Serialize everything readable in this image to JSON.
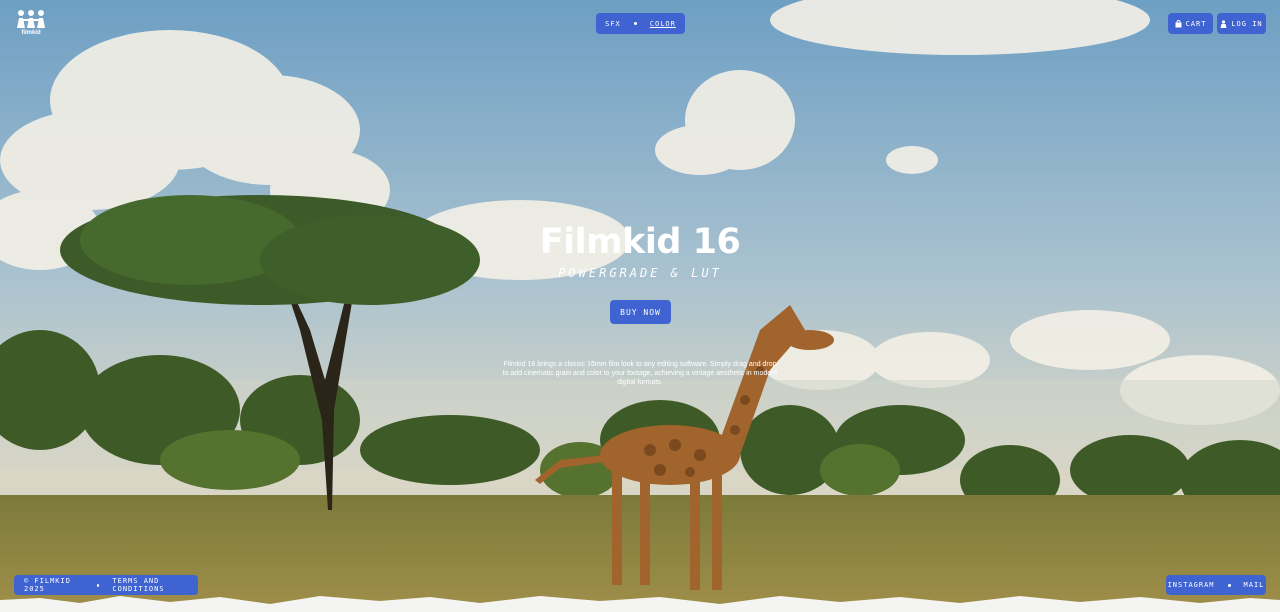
{
  "brand": {
    "logo_text": "filmkid"
  },
  "nav": {
    "sfx_label": "SFX",
    "color_label": "COLOR",
    "cart_label": "CART",
    "login_label": "LOG IN"
  },
  "hero": {
    "title": "Filmkid 16",
    "subtitle": "POWERGRADE & LUT",
    "cta_label": "BUY NOW",
    "description": "Filmkid 16 brings a classic 16mm film look to any editing software. Simply drag and drop to add cinematic grain and color to your footage, achieving a vintage aesthetic in modern digital formats."
  },
  "footer": {
    "copyright": "© FILMKID 2025",
    "terms_label": "TERMS AND CONDITIONS",
    "instagram_label": "INSTAGRAM",
    "mail_label": "MAIL"
  },
  "colors": {
    "accent": "#3f63d1",
    "sky": "#7fa6c6"
  },
  "icons": {
    "cart": "bag-icon",
    "login": "person-icon",
    "logo": "three-kids-logo-icon"
  }
}
